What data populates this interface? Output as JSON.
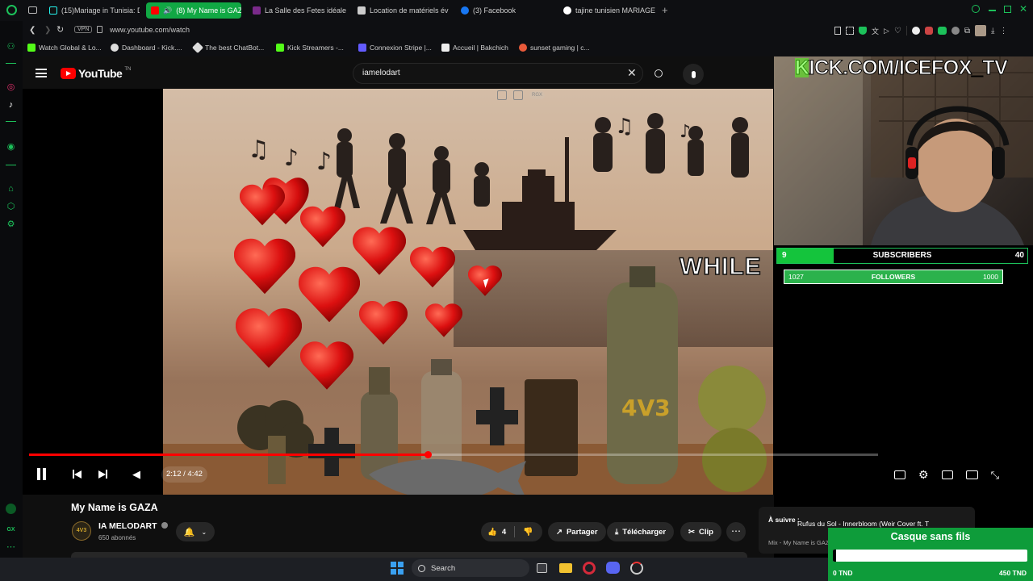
{
  "browser": {
    "tabs": [
      {
        "label": "(15)Mariage in Tunisia: De",
        "icon": "tiktok-icon",
        "color": "#000000"
      },
      {
        "label": "(8) My Name is GAZA",
        "icon": "youtube-icon",
        "color": "#ff0000",
        "active": true
      },
      {
        "label": "La Salle des Fetes idéale",
        "icon": "site-icon",
        "color": "#7a2a8a"
      },
      {
        "label": "Location de matériels év",
        "icon": "site-icon",
        "color": "#cccccc"
      },
      {
        "label": "(3) Facebook",
        "icon": "facebook-icon",
        "color": "#1877f2"
      },
      {
        "label": "tajine tunisien MARIAGE",
        "icon": "google-icon",
        "color": "#ffffff"
      }
    ],
    "vpn_label": "VPN",
    "url": "www.youtube.com/watch",
    "bookmarks": [
      "Watch Global & Lo...",
      "Dashboard - Kick....",
      "The best ChatBot...",
      "Kick Streamers -...",
      "Connexion Stripe |...",
      "Accueil | Bakchich",
      "sunset gaming | c..."
    ]
  },
  "youtube": {
    "logo": "YouTube",
    "logo_suffix": "TN",
    "search_value": "iamelodart",
    "video": {
      "time": "2:12 / 4:42",
      "progress": 0.47,
      "watermark": "RGX"
    },
    "title": "My Name is GAZA",
    "channel": {
      "name": "IA MELODART",
      "subscribers": "650 abonnés"
    },
    "actions": {
      "like_count": "4",
      "share": "Partager",
      "download": "Télécharger",
      "clip": "Clip"
    },
    "up_next": {
      "prefix": "À suivre :",
      "title": "Rufus du Sol - Innerbloom (Weir Cover ft. T",
      "meta": "Mix - My Name is GAZ"
    }
  },
  "stream": {
    "banner": "KICK.COM/ICEFOX_TV",
    "video_text": "WHILE",
    "subs_current": "9",
    "subs_label": "SUBSCRIBERS",
    "subs_goal": "40",
    "subs_progress": 0.225,
    "followers_current": "1027",
    "followers_label": "FOLLOWERS",
    "followers_goal": "1000",
    "followers_progress": 1.0,
    "donation_title": "Casque sans fils",
    "donation_min": "0 TND",
    "donation_max": "450 TND",
    "donation_progress": 0.01
  },
  "taskbar": {
    "search_label": "Search"
  },
  "colors": {
    "brand_green": "#11a844",
    "kick_green": "#53fc18",
    "youtube_red": "#ff0000"
  }
}
